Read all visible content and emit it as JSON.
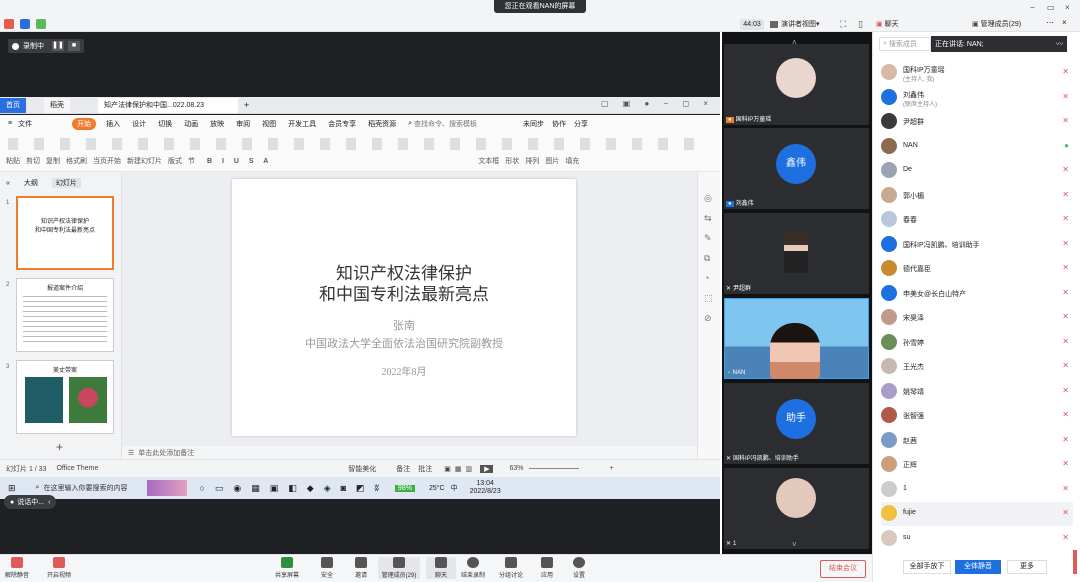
{
  "topbar": {
    "share_banner": "您正在观看NAN的屏幕",
    "timer": "44:03",
    "view_mode": "演讲者视图",
    "chat_label": "聊天",
    "members_tab": "管理成员(29)"
  },
  "recording": {
    "label": "录制中"
  },
  "wps": {
    "tab_home": "首页",
    "tab_dr": "稻壳",
    "tab_doc": "知产法律保护和中国...022.08.23",
    "menu": [
      "文件",
      "开始",
      "插入",
      "设计",
      "切换",
      "动画",
      "放映",
      "审阅",
      "视图",
      "开发工具",
      "会员专享",
      "稻壳资源"
    ],
    "search_placeholder": "查找命令、搜索模板",
    "sync": "未同步",
    "collab": "协作",
    "share": "分享",
    "ribbon": [
      "粘贴",
      "剪切",
      "复制",
      "格式刷",
      "当页开始",
      "新建幻灯片",
      "版式",
      "节",
      "重置",
      "文本框",
      "形状",
      "排列",
      "图片",
      "填充",
      "轮廓"
    ],
    "pane_tabs": [
      "大纲",
      "幻灯片"
    ],
    "notes": "单击此处添加备注",
    "status_left": "幻灯片 1 / 33",
    "theme": "Office Theme",
    "smart": "智能美化",
    "notes_btn": "备注",
    "comment_btn": "批注",
    "zoom": "63%"
  },
  "slide": {
    "title1": "知识产权法律保护",
    "title2": "和中国专利法最新亮点",
    "author": "张南",
    "affiliation": "中国政法大学全面依法治国研究院副教授",
    "date": "2022年8月"
  },
  "thumbs": [
    {
      "num": "1",
      "title": "知识产权法律保护\n和中国专利法最新亮点"
    },
    {
      "num": "2",
      "title": "报道案件介绍"
    },
    {
      "num": "3",
      "title": "美丈带案"
    }
  ],
  "taskbar": {
    "search": "在这里输入你要搜索的内容",
    "temp": "25°C",
    "lang": "中",
    "time": "13:04",
    "date": "2022/8/23",
    "pct": "98%"
  },
  "videos": [
    {
      "label": "国科IP万童瑶"
    },
    {
      "label": "刘鑫伟",
      "avatar": "鑫伟"
    },
    {
      "label": "尹超群"
    },
    {
      "label": "NAN"
    },
    {
      "label": "国科IP冯凯鹏、培训助手",
      "avatar": "助手"
    },
    {
      "label": "1"
    }
  ],
  "members": {
    "search_placeholder": "搜索成员",
    "speaking": "正在讲话: NAN;",
    "list": [
      {
        "name": "国科IP万童瑶",
        "role": "(主持人, 我)"
      },
      {
        "name": "刘鑫伟",
        "role": "(联席主持人)"
      },
      {
        "name": "尹超群",
        "role": ""
      },
      {
        "name": "NAN",
        "role": ""
      },
      {
        "name": "De",
        "role": ""
      },
      {
        "name": "郭小楣",
        "role": ""
      },
      {
        "name": "春春",
        "role": ""
      },
      {
        "name": "国科IP冯凯鹏、培训助手",
        "role": ""
      },
      {
        "name": "德代嘉臣",
        "role": ""
      },
      {
        "name": "申美女@长白山特产",
        "role": ""
      },
      {
        "name": "宋昊泽",
        "role": ""
      },
      {
        "name": "孙雪婷",
        "role": ""
      },
      {
        "name": "王光杰",
        "role": ""
      },
      {
        "name": "姚琴靖",
        "role": ""
      },
      {
        "name": "张智强",
        "role": ""
      },
      {
        "name": "赵茜",
        "role": ""
      },
      {
        "name": "正辉",
        "role": ""
      },
      {
        "name": "1",
        "role": ""
      },
      {
        "name": "fujie",
        "role": ""
      },
      {
        "name": "su",
        "role": ""
      }
    ],
    "all_hands": "全部手放下",
    "mute_all": "全体静音",
    "more": "更多"
  },
  "bottom": {
    "unmute": "解除静音",
    "video": "开启视频",
    "share": "共享屏幕",
    "security": "安全",
    "invite": "邀请",
    "members": "管理成员(29)",
    "chat": "聊天",
    "rec": "结束录制",
    "breakout": "分组讨论",
    "apps": "应用",
    "settings": "设置",
    "end": "结束会议",
    "speaking_now": "说话中..."
  }
}
